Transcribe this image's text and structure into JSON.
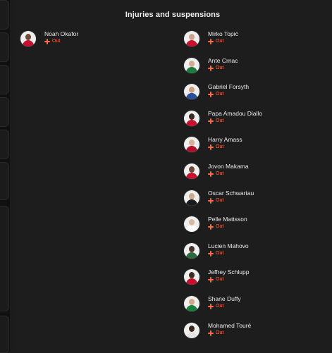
{
  "section": {
    "title": "Injuries and suspensions"
  },
  "left_column": [
    {
      "name": "Noah Okafor",
      "status": "Out",
      "skin": "#6b4a3a",
      "kit": "#c8102e"
    }
  ],
  "right_column": [
    {
      "name": "Mirko Topić",
      "status": "Out",
      "skin": "#c9a48a",
      "kit": "#c8102e"
    },
    {
      "name": "Ante Crnac",
      "status": "Out",
      "skin": "#d2ab90",
      "kit": "#1e7a3c"
    },
    {
      "name": "Gabriel Forsyth",
      "status": "Out",
      "skin": "#caa183",
      "kit": "#2a4e9a"
    },
    {
      "name": "Papa Amadou Diallo",
      "status": "Out",
      "skin": "#3a2a22",
      "kit": "#c8102e"
    },
    {
      "name": "Harry Amass",
      "status": "Out",
      "skin": "#d7b196",
      "kit": "#b0102a"
    },
    {
      "name": "Jovon Makama",
      "status": "Out",
      "skin": "#6a4b3a",
      "kit": "#c8102e"
    },
    {
      "name": "Oscar Schwartau",
      "status": "Out",
      "skin": "#cfa98c",
      "kit": "#1a1a1a"
    },
    {
      "name": "Pelle Mattsson",
      "status": "Out",
      "skin": "#d9b89e",
      "kit": "#ffffff"
    },
    {
      "name": "Lucien Mahovo",
      "status": "Out",
      "skin": "#4a3428",
      "kit": "#2d6b3f"
    },
    {
      "name": "Jeffrey Schlupp",
      "status": "Out",
      "skin": "#3d2a20",
      "kit": "#c8102e"
    },
    {
      "name": "Shane Duffy",
      "status": "Out",
      "skin": "#d3a88a",
      "kit": "#15803d"
    },
    {
      "name": "Mohamed Touré",
      "status": "Out",
      "skin": "#3a281e",
      "kit": "#e5e5e5"
    }
  ],
  "colors": {
    "out": "#ff6b4a",
    "background": "#1d1d1d"
  }
}
